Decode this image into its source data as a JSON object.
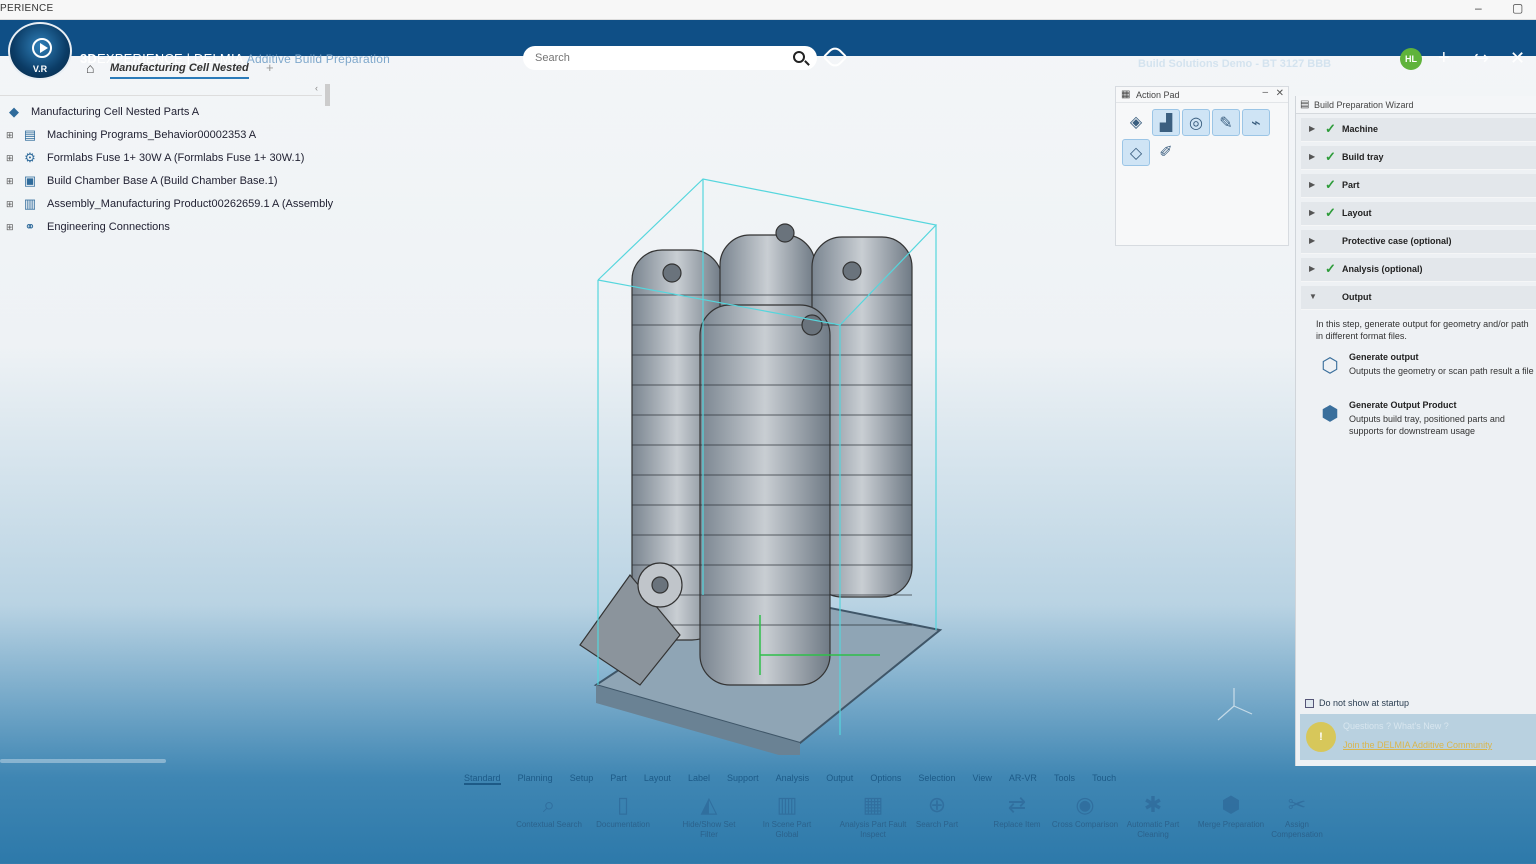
{
  "window": {
    "title": "PERIENCE",
    "minimize": "–",
    "close": "▢"
  },
  "brand": {
    "prefix": "3D",
    "name": "EXPERIENCE | DELMIA",
    "app": "Additive Build Preparation",
    "version": "V.R"
  },
  "search": {
    "placeholder": "Search"
  },
  "user": {
    "info": "Build Solutions Demo - BT 3127 BBB"
  },
  "avatar": {
    "initials": "HL"
  },
  "tab": {
    "title": "Manufacturing Cell Nested"
  },
  "tree": {
    "root": "Manufacturing Cell Nested Parts A",
    "items": [
      "Machining Programs_Behavior00002353 A",
      "Formlabs Fuse 1+ 30W A (Formlabs Fuse 1+ 30W.1)",
      "Build Chamber Base A (Build Chamber Base.1)",
      "Assembly_Manufacturing Product00262659.1 A (Assembly",
      "Engineering Connections"
    ]
  },
  "action_pad": {
    "title": "Action Pad"
  },
  "wizard": {
    "title": "Build Preparation Wizard",
    "steps": [
      {
        "label": "Machine",
        "done": true
      },
      {
        "label": "Build tray",
        "done": true
      },
      {
        "label": "Part",
        "done": true
      },
      {
        "label": "Layout",
        "done": true
      },
      {
        "label": "Protective case (optional)",
        "done": false
      },
      {
        "label": "Analysis (optional)",
        "done": true
      },
      {
        "label": "Output",
        "done": false,
        "expanded": true
      }
    ],
    "output_description": "In this step, generate output for geometry and/or path in different format files.",
    "options": [
      {
        "title": "Generate output",
        "desc": "Outputs the geometry or scan path result a file"
      },
      {
        "title": "Generate Output Product",
        "desc": "Outputs build tray, positioned parts and supports for downstream usage"
      }
    ],
    "dont_show": "Do not show at startup",
    "question": "Questions ? What's New ?",
    "question_link": "Join the DELMIA Additive Community"
  },
  "bottom_tabs": [
    "Standard",
    "Planning",
    "Setup",
    "Part",
    "Layout",
    "Label",
    "Support",
    "Analysis",
    "Output",
    "Options",
    "Selection",
    "View",
    "AR-VR",
    "Tools",
    "Touch"
  ],
  "toolbar": [
    {
      "icon": "magnifier-icon",
      "label": "Contextual Search"
    },
    {
      "icon": "book-icon",
      "label": "Documentation"
    },
    {
      "icon": "hide-show-icon",
      "label": "Hide/Show Set Filter"
    },
    {
      "icon": "in-scene-icon",
      "label": "In Scene Part Global"
    },
    {
      "icon": "analysis-icon",
      "label": "Analysis Part Fault Inspect"
    },
    {
      "icon": "search-part-icon",
      "label": "Search Part"
    },
    {
      "icon": "replace-icon",
      "label": "Replace Item"
    },
    {
      "icon": "cross-section-icon",
      "label": "Cross Comparison"
    },
    {
      "icon": "automatic-icon",
      "label": "Automatic Part Cleaning"
    },
    {
      "icon": "merge-icon",
      "label": "Merge Preparation"
    },
    {
      "icon": "assign-icon",
      "label": "Assign Compensation"
    }
  ]
}
